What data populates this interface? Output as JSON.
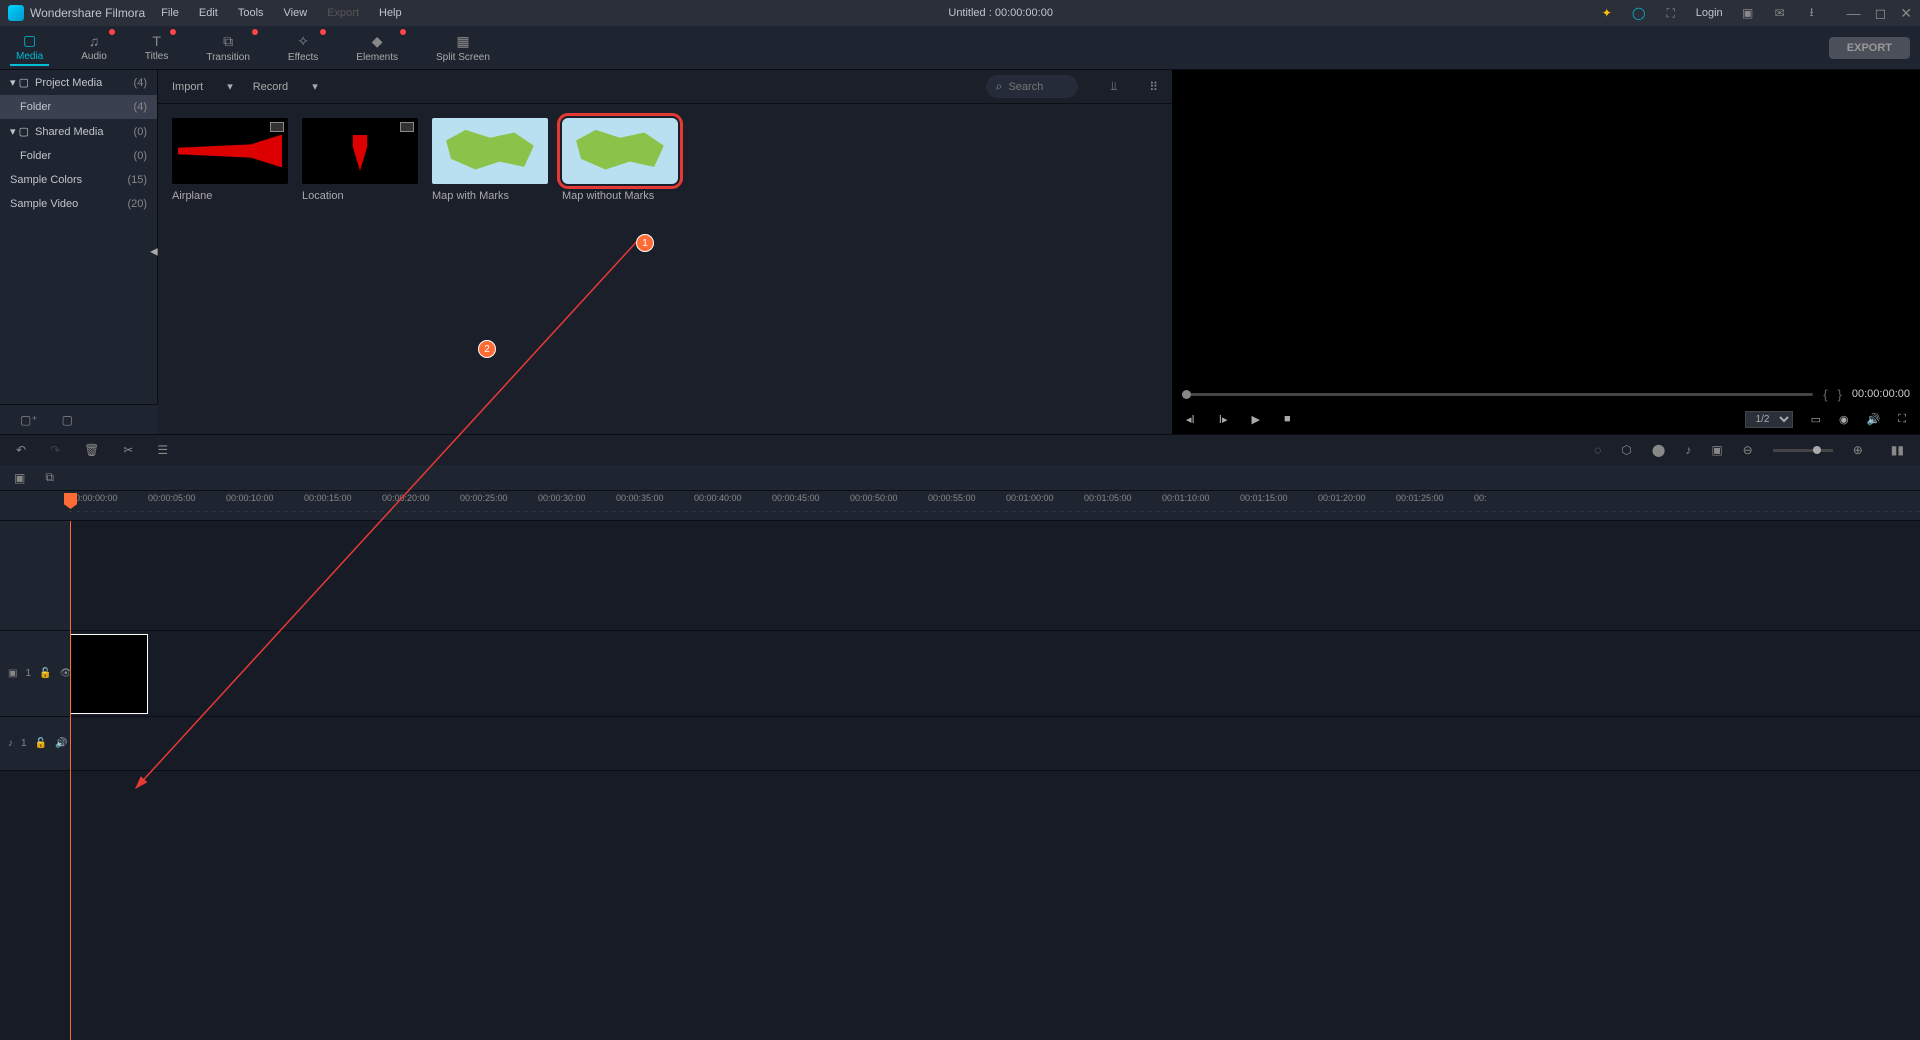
{
  "app": {
    "name": "Wondershare Filmora"
  },
  "menu": {
    "file": "File",
    "edit": "Edit",
    "tools": "Tools",
    "view": "View",
    "export": "Export",
    "help": "Help"
  },
  "title": "Untitled : 00:00:00:00",
  "login": "Login",
  "ribbon": {
    "media": "Media",
    "audio": "Audio",
    "titles": "Titles",
    "transition": "Transition",
    "effects": "Effects",
    "elements": "Elements",
    "split": "Split Screen"
  },
  "export_btn": "EXPORT",
  "sidebar": {
    "project": {
      "label": "Project Media",
      "count": "(4)"
    },
    "folder": {
      "label": "Folder",
      "count": "(4)"
    },
    "shared": {
      "label": "Shared Media",
      "count": "(0)"
    },
    "folder2": {
      "label": "Folder",
      "count": "(0)"
    },
    "colors": {
      "label": "Sample Colors",
      "count": "(15)"
    },
    "video": {
      "label": "Sample Video",
      "count": "(20)"
    }
  },
  "browser": {
    "import": "Import",
    "record": "Record",
    "search": "Search"
  },
  "thumbs": {
    "airplane": "Airplane",
    "location": "Location",
    "map_marks": "Map with Marks",
    "map_nomarks": "Map without Marks"
  },
  "preview": {
    "timecode": "00:00:00:00",
    "ratio": "1/2"
  },
  "ruler": [
    "00:00:00:00",
    "00:00:05:00",
    "00:00:10:00",
    "00:00:15:00",
    "00:00:20:00",
    "00:00:25:00",
    "00:00:30:00",
    "00:00:35:00",
    "00:00:40:00",
    "00:00:45:00",
    "00:00:50:00",
    "00:00:55:00",
    "00:01:00:00",
    "00:01:05:00",
    "00:01:10:00",
    "00:01:15:00",
    "00:01:20:00",
    "00:01:25:00",
    "00:"
  ],
  "annotations": {
    "b1": "1",
    "b2": "2"
  },
  "track": {
    "video": "1",
    "audio": "1"
  }
}
